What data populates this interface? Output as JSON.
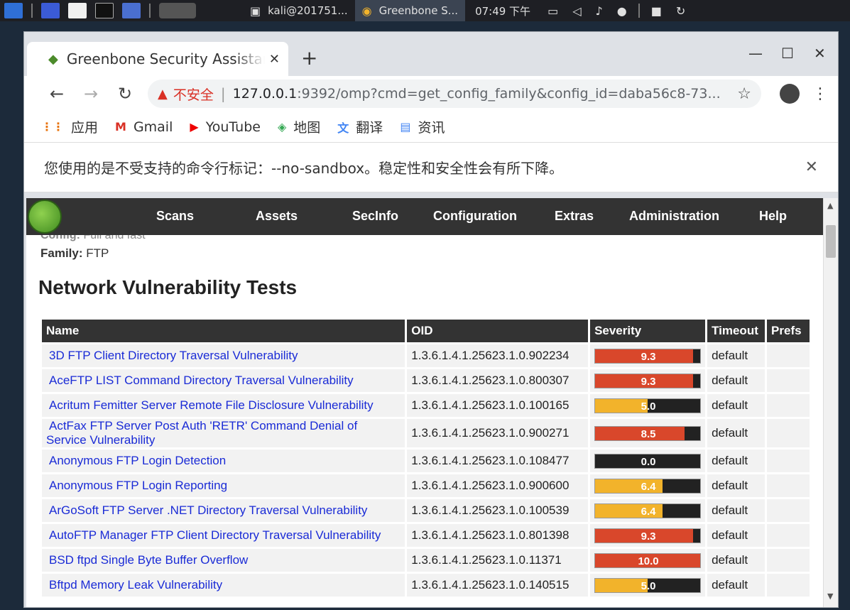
{
  "taskbar": {
    "tasks": [
      {
        "label": "kali@201751...",
        "icon": "terminal-icon"
      },
      {
        "label": "Greenbone S...",
        "icon": "chrome-icon"
      }
    ],
    "clock": "07:49 下午"
  },
  "browser": {
    "tab_title": "Greenbone Security Assistant",
    "insecure_label": "不安全",
    "url_host": "127.0.0.1",
    "url_rest": ":9392/omp?cmd=get_config_family&config_id=daba56c8-73...",
    "bookmarks": [
      {
        "label": "应用",
        "icon": "apps-grid-icon"
      },
      {
        "label": "Gmail",
        "icon": "gmail-icon"
      },
      {
        "label": "YouTube",
        "icon": "youtube-icon"
      },
      {
        "label": "地图",
        "icon": "maps-icon"
      },
      {
        "label": "翻译",
        "icon": "translate-icon"
      },
      {
        "label": "资讯",
        "icon": "news-icon"
      }
    ],
    "infobar_text": "您使用的是不受支持的命令行标记：--no-sandbox。稳定性和安全性会有所下降。"
  },
  "nav": {
    "items": [
      "Scans",
      "Assets",
      "SecInfo",
      "Configuration",
      "Extras",
      "Administration",
      "Help"
    ]
  },
  "meta": {
    "config_label": "Config:",
    "config_value": "Full and fast",
    "family_label": "Family:",
    "family_value": "FTP"
  },
  "heading": "Network Vulnerability Tests",
  "table": {
    "headers": {
      "name": "Name",
      "oid": "OID",
      "severity": "Severity",
      "timeout": "Timeout",
      "prefs": "Prefs"
    },
    "rows": [
      {
        "name": "3D FTP Client Directory Traversal Vulnerability",
        "oid": "1.3.6.1.4.1.25623.1.0.902234",
        "severity": "9.3",
        "timeout": "default"
      },
      {
        "name": "AceFTP LIST Command Directory Traversal Vulnerability",
        "oid": "1.3.6.1.4.1.25623.1.0.800307",
        "severity": "9.3",
        "timeout": "default"
      },
      {
        "name": "Acritum Femitter Server Remote File Disclosure Vulnerability",
        "oid": "1.3.6.1.4.1.25623.1.0.100165",
        "severity": "5.0",
        "timeout": "default"
      },
      {
        "name": "ActFax FTP Server Post Auth 'RETR' Command Denial of Service Vulnerability",
        "oid": "1.3.6.1.4.1.25623.1.0.900271",
        "severity": "8.5",
        "timeout": "default"
      },
      {
        "name": "Anonymous FTP Login Detection",
        "oid": "1.3.6.1.4.1.25623.1.0.108477",
        "severity": "0.0",
        "timeout": "default"
      },
      {
        "name": "Anonymous FTP Login Reporting",
        "oid": "1.3.6.1.4.1.25623.1.0.900600",
        "severity": "6.4",
        "timeout": "default"
      },
      {
        "name": "ArGoSoft FTP Server .NET Directory Traversal Vulnerability",
        "oid": "1.3.6.1.4.1.25623.1.0.100539",
        "severity": "6.4",
        "timeout": "default"
      },
      {
        "name": "AutoFTP Manager FTP Client Directory Traversal Vulnerability",
        "oid": "1.3.6.1.4.1.25623.1.0.801398",
        "severity": "9.3",
        "timeout": "default"
      },
      {
        "name": "BSD ftpd Single Byte Buffer Overflow",
        "oid": "1.3.6.1.4.1.25623.1.0.11371",
        "severity": "10.0",
        "timeout": "default"
      },
      {
        "name": "Bftpd Memory Leak Vulnerability",
        "oid": "1.3.6.1.4.1.25623.1.0.140515",
        "severity": "5.0",
        "timeout": "default"
      }
    ]
  },
  "colors": {
    "severity_high": "#d9472b",
    "severity_medium": "#f2b32b",
    "severity_bar_bg": "#222222",
    "nav_bg": "#333333",
    "link": "#1a2bd6"
  }
}
